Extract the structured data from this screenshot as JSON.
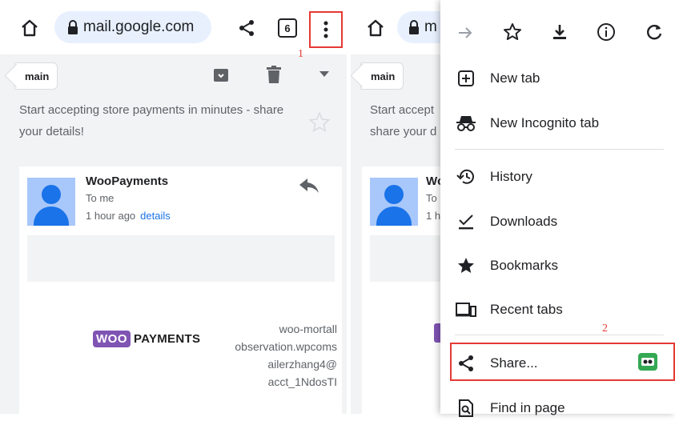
{
  "left": {
    "url": "mail.google.com",
    "tab_count": "6",
    "label_chip": "main",
    "subject": "Start accepting store payments in minutes - share your details!",
    "email": {
      "sender": "WooPayments",
      "to": "To me",
      "time": "1 hour ago",
      "details": "details"
    },
    "logo": {
      "badge": "WOO",
      "word": "PAYMENTS"
    },
    "info_lines": [
      "woo-mortall",
      "observation.wpcoms",
      "ailerzhang4@",
      "acct_1NdosTI"
    ],
    "step_label": "1"
  },
  "right": {
    "url_partial": "m",
    "label_chip": "main",
    "subject_partial": "Start accept share your d",
    "subject_lines": [
      "Start accept",
      "share your d"
    ],
    "sender_partial": "Wc",
    "to_partial": "To",
    "time_partial": "1 h",
    "step_label": "2",
    "menu": {
      "items": [
        {
          "label": "New tab",
          "icon": "new-tab-icon"
        },
        {
          "label": "New Incognito tab",
          "icon": "incognito-icon"
        },
        {
          "label": "History",
          "icon": "history-icon"
        },
        {
          "label": "Downloads",
          "icon": "downloads-icon"
        },
        {
          "label": "Bookmarks",
          "icon": "bookmarks-star-icon"
        },
        {
          "label": "Recent tabs",
          "icon": "recent-tabs-icon"
        },
        {
          "label": "Share...",
          "icon": "share-icon"
        },
        {
          "label": "Find in page",
          "icon": "find-in-page-icon"
        }
      ]
    }
  },
  "colors": {
    "highlight": "#e53935",
    "accent": "#1a73e8",
    "woo_purple": "#7f54b3"
  }
}
